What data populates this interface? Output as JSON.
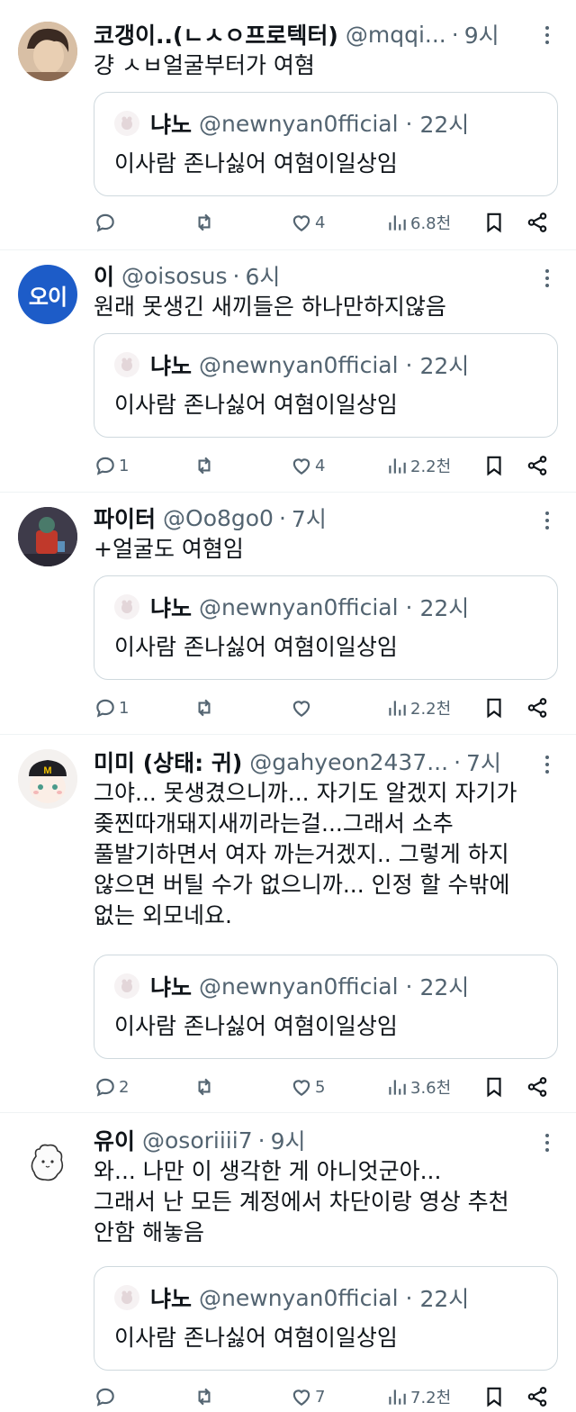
{
  "colors": {
    "text": "#0f1419",
    "secondary": "#536471",
    "border": "#cfd9de",
    "divider": "#eff3f4"
  },
  "tweets": [
    {
      "name": "코갱이..(ㄴㅅㅇ프로텍터)",
      "handle": "@mqqi...",
      "time": "9시",
      "text": [
        "걍 ㅅㅂ얼굴부터가 여혐"
      ],
      "quote": {
        "name": "냐노",
        "handle": "@newnyan0fficial",
        "time": "22시",
        "text": "이사람 존나싫어 여혐이일상임"
      },
      "replies": "",
      "likes": "4",
      "views": "6.8천"
    },
    {
      "name": "이",
      "handle": "@oisosus",
      "time": "6시",
      "avatar_text": "오이",
      "text": [
        "원래 못생긴 새끼들은 하나만하지않음"
      ],
      "quote": {
        "name": "냐노",
        "handle": "@newnyan0fficial",
        "time": "22시",
        "text": "이사람 존나싫어 여혐이일상임"
      },
      "replies": "1",
      "likes": "4",
      "views": "2.2천"
    },
    {
      "name": "파이터",
      "handle": "@Oo8go0",
      "time": "7시",
      "text": [
        "+얼굴도 여혐임"
      ],
      "quote": {
        "name": "냐노",
        "handle": "@newnyan0fficial",
        "time": "22시",
        "text": "이사람 존나싫어 여혐이일상임"
      },
      "replies": "1",
      "likes": "",
      "views": "2.2천"
    },
    {
      "name": "미미 (상태: 귀)",
      "handle": "@gahyeon2437...",
      "time": "7시",
      "text": [
        "그야... 못생겼으니까... 자기도 알겠지 자기가",
        "좆찐따개돼지새끼라는걸...그래서 소추",
        "풀발기하면서 여자 까는거겠지.. 그렇게 하지",
        "않으면 버틸 수가 없으니까... 인정 할 수밖에",
        "없는 외모네요."
      ],
      "quote": {
        "name": "냐노",
        "handle": "@newnyan0fficial",
        "time": "22시",
        "text": "이사람 존나싫어 여혐이일상임"
      },
      "replies": "2",
      "likes": "5",
      "views": "3.6천"
    },
    {
      "name": "유이",
      "handle": "@osoriiii7",
      "time": "9시",
      "text": [
        "와... 나만 이 생각한 게 아니엇군아...",
        "그래서 난 모든 계정에서 차단이랑 영상 추천",
        "안함 해놓음"
      ],
      "quote": {
        "name": "냐노",
        "handle": "@newnyan0fficial",
        "time": "22시",
        "text": "이사람 존나싫어 여혐이일상임"
      },
      "replies": "",
      "likes": "7",
      "views": "7.2천"
    }
  ]
}
